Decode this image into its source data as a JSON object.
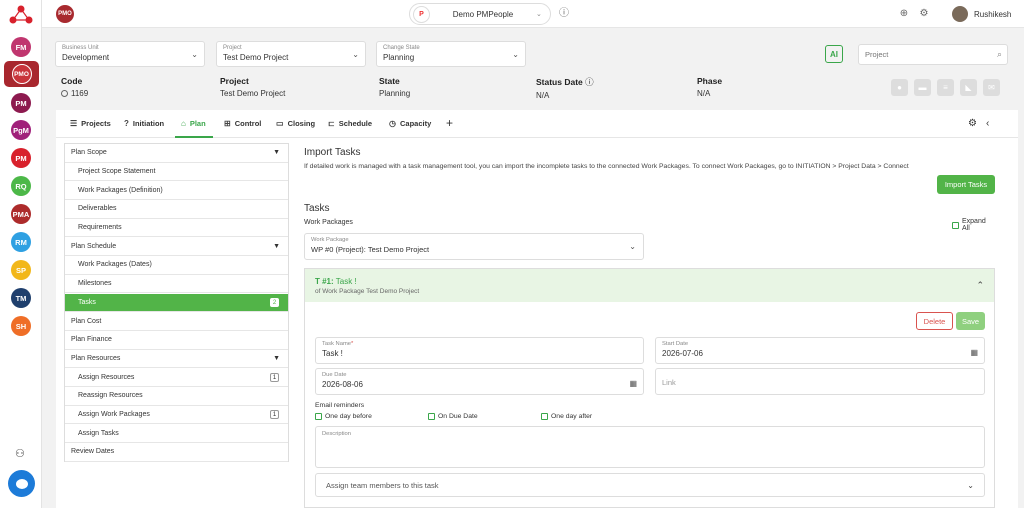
{
  "rail": {
    "avatars": [
      {
        "label": "FM",
        "color": "#c0366f"
      },
      {
        "label": "PM",
        "color": "#8d1a4f"
      },
      {
        "label": "PgM",
        "color": "#a0207a"
      },
      {
        "label": "PM",
        "color": "#d8212c"
      },
      {
        "label": "RQ",
        "color": "#4cb848"
      },
      {
        "label": "PMA",
        "color": "#ad2b2b"
      },
      {
        "label": "RM",
        "color": "#2fa0e2"
      },
      {
        "label": "SP",
        "color": "#f2b71a"
      },
      {
        "label": "TM",
        "color": "#1f3f6d"
      },
      {
        "label": "SH",
        "color": "#ef6e27"
      }
    ],
    "selected": "PMO"
  },
  "topbar": {
    "pmo": "PMO",
    "org_name": "Demo PMPeople",
    "user_name": "Rushikesh"
  },
  "filters": {
    "business_unit": {
      "label": "Business Unit",
      "value": "Development"
    },
    "project": {
      "label": "Project",
      "value": "Test Demo Project"
    },
    "change_state": {
      "label": "Change State",
      "value": "Planning"
    },
    "search_placeholder": "Project"
  },
  "info": {
    "code": {
      "label": "Code",
      "value": "1169"
    },
    "project": {
      "label": "Project",
      "value": "Test Demo Project"
    },
    "state": {
      "label": "State",
      "value": "Planning"
    },
    "status_date": {
      "label": "Status Date",
      "value": "N/A"
    },
    "phase": {
      "label": "Phase",
      "value": "N/A"
    }
  },
  "tabs": [
    {
      "label": "Projects",
      "icon": "≡"
    },
    {
      "label": "Initiation",
      "icon": "?"
    },
    {
      "label": "Plan",
      "icon": "⌂"
    },
    {
      "label": "Control",
      "icon": "⊞"
    },
    {
      "label": "Closing",
      "icon": "▭"
    },
    {
      "label": "Schedule",
      "icon": "⊏"
    },
    {
      "label": "Capacity",
      "icon": "◷"
    }
  ],
  "menu": [
    {
      "label": "Plan Scope",
      "type": "sec",
      "caret": true
    },
    {
      "label": "Project Scope Statement",
      "type": "sub"
    },
    {
      "label": "Work Packages (Definition)",
      "type": "sub"
    },
    {
      "label": "Deliverables",
      "type": "sub"
    },
    {
      "label": "Requirements",
      "type": "sub"
    },
    {
      "label": "Plan Schedule",
      "type": "sec",
      "caret": true
    },
    {
      "label": "Work Packages (Dates)",
      "type": "sub"
    },
    {
      "label": "Milestones",
      "type": "sub"
    },
    {
      "label": "Tasks",
      "type": "sub",
      "active": true,
      "badge": "2"
    },
    {
      "label": "Plan Cost",
      "type": "sec"
    },
    {
      "label": "Plan Finance",
      "type": "sec"
    },
    {
      "label": "Plan Resources",
      "type": "sec",
      "caret": true
    },
    {
      "label": "Assign Resources",
      "type": "sub",
      "badge": "1"
    },
    {
      "label": "Reassign Resources",
      "type": "sub"
    },
    {
      "label": "Assign Work Packages",
      "type": "sub",
      "badge": "1"
    },
    {
      "label": "Assign Tasks",
      "type": "sub"
    },
    {
      "label": "Review Dates",
      "type": "sec"
    }
  ],
  "content": {
    "import_title": "Import Tasks",
    "import_desc": "If detailed work is managed with a task management tool, you can import the incomplete tasks to the connected Work Packages. To connect Work Packages, go to INITIATION > Project Data > Connect",
    "import_button": "Import Tasks",
    "tasks_title": "Tasks",
    "wp_label": "Work Packages",
    "expand_all": "Expand All",
    "wp_select": {
      "label": "Work Package",
      "value": "WP #0 (Project): Test Demo Project"
    },
    "task": {
      "id": "T #1:",
      "name_inline": "Task !",
      "subtitle": "of Work Package Test Demo Project",
      "delete": "Delete",
      "save": "Save",
      "task_name": {
        "label": "Task Name",
        "value": "Task !"
      },
      "start_date": {
        "label": "Start Date",
        "value": "2026-07-06"
      },
      "due_date": {
        "label": "Due Date",
        "value": "2026-08-06"
      },
      "link_placeholder": "Link",
      "email_reminders": "Email reminders",
      "reminders": [
        "One day before",
        "On Due Date",
        "One day after"
      ],
      "description_label": "Description",
      "assign_label": "Assign team members to this task"
    }
  }
}
